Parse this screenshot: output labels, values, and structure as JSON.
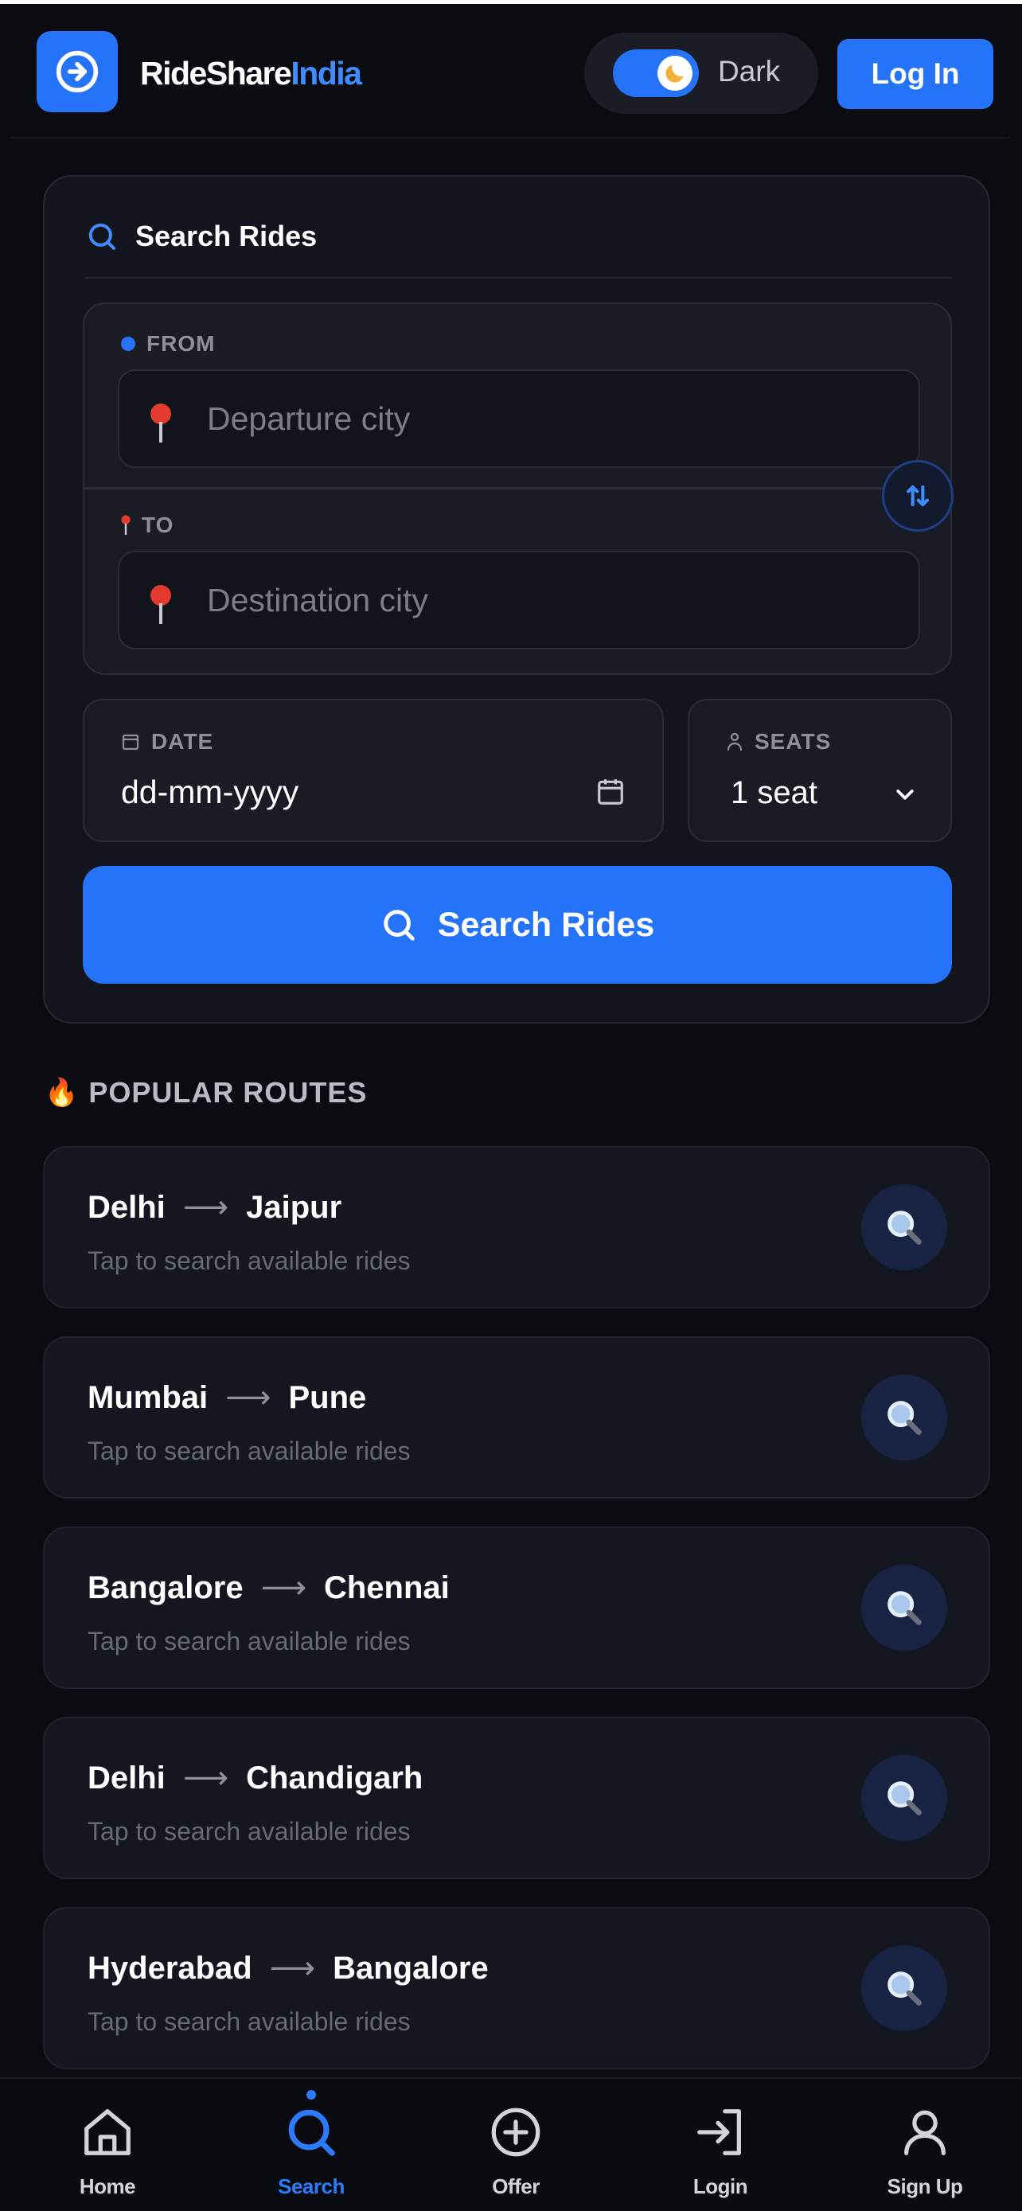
{
  "header": {
    "brand_main": "RideShare",
    "brand_accent": "India",
    "theme_label": "Dark",
    "login_label": "Log In"
  },
  "search": {
    "title": "Search Rides",
    "from_label": "FROM",
    "from_placeholder": "Departure city",
    "to_label": "TO",
    "to_placeholder": "Destination city",
    "date_label": "DATE",
    "date_value": "dd-mm-yyyy",
    "seats_label": "SEATS",
    "seats_value": "1 seat",
    "button_label": "Search Rides"
  },
  "popular": {
    "title": "POPULAR ROUTES",
    "routes": [
      {
        "from": "Delhi",
        "to": "Jaipur",
        "subtitle": "Tap to search available rides"
      },
      {
        "from": "Mumbai",
        "to": "Pune",
        "subtitle": "Tap to search available rides"
      },
      {
        "from": "Bangalore",
        "to": "Chennai",
        "subtitle": "Tap to search available rides"
      },
      {
        "from": "Delhi",
        "to": "Chandigarh",
        "subtitle": "Tap to search available rides"
      },
      {
        "from": "Hyderabad",
        "to": "Bangalore",
        "subtitle": "Tap to search available rides"
      }
    ]
  },
  "nav": {
    "items": [
      {
        "label": "Home",
        "icon": "home-icon"
      },
      {
        "label": "Search",
        "icon": "search-icon"
      },
      {
        "label": "Offer",
        "icon": "plus-circle-icon"
      },
      {
        "label": "Login",
        "icon": "login-icon"
      },
      {
        "label": "Sign Up",
        "icon": "user-icon"
      }
    ],
    "active": "Search"
  },
  "colors": {
    "accent": "#2473f8",
    "background": "#0b0c12",
    "card": "#13151e"
  }
}
